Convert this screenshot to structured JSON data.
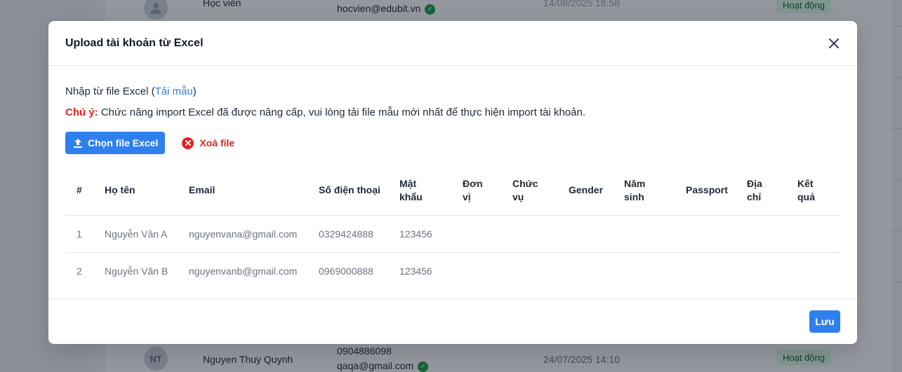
{
  "background": {
    "rows": [
      {
        "name": "Học viên",
        "email": "hocvien@edubit.vn",
        "phone": "",
        "date": "14/08/2025 16:58",
        "status": "Hoạt động",
        "avatar_text": ""
      },
      {
        "name": "Nguyen Thuy Quynh",
        "email": "qaqa@gmail.com",
        "phone": "0904886098",
        "date": "24/07/2025 14:10",
        "status": "Hoạt động",
        "avatar_text": "NT"
      }
    ]
  },
  "modal": {
    "title": "Upload tài khoản từ Excel",
    "close_icon": "close-icon",
    "import_prefix": "Nhập từ file Excel (",
    "template_link": "Tải mẫu",
    "import_suffix": ")",
    "note_label": "Chú ý:",
    "note_text": " Chức năng import Excel đã được nâng cấp, vui lòng tải file mẫu mới nhất để thực hiện import tài khoản.",
    "choose_file_label": "Chọn file Excel",
    "delete_file_label": "Xoá file",
    "save_label": "Lưu",
    "table": {
      "headers": [
        "#",
        "Họ tên",
        "Email",
        "Số điện thoại",
        "Mật khẩu",
        "Đơn vị",
        "Chức vụ",
        "Gender",
        "Năm sinh",
        "Passport",
        "Địa chỉ",
        "Kết quả"
      ],
      "rows": [
        [
          "1",
          "Nguyễn Văn A",
          "nguyenvana@gmail.com",
          "0329424888",
          "123456",
          "",
          "",
          "",
          "",
          "",
          "",
          ""
        ],
        [
          "2",
          "Nguyễn Văn B",
          "nguyenvanb@gmail.com",
          "0969000888",
          "123456",
          "",
          "",
          "",
          "",
          "",
          "",
          ""
        ]
      ]
    }
  },
  "colors": {
    "primary": "#2f80ed",
    "danger": "#e02424",
    "overlay": "rgba(17,24,39,0.45)"
  }
}
